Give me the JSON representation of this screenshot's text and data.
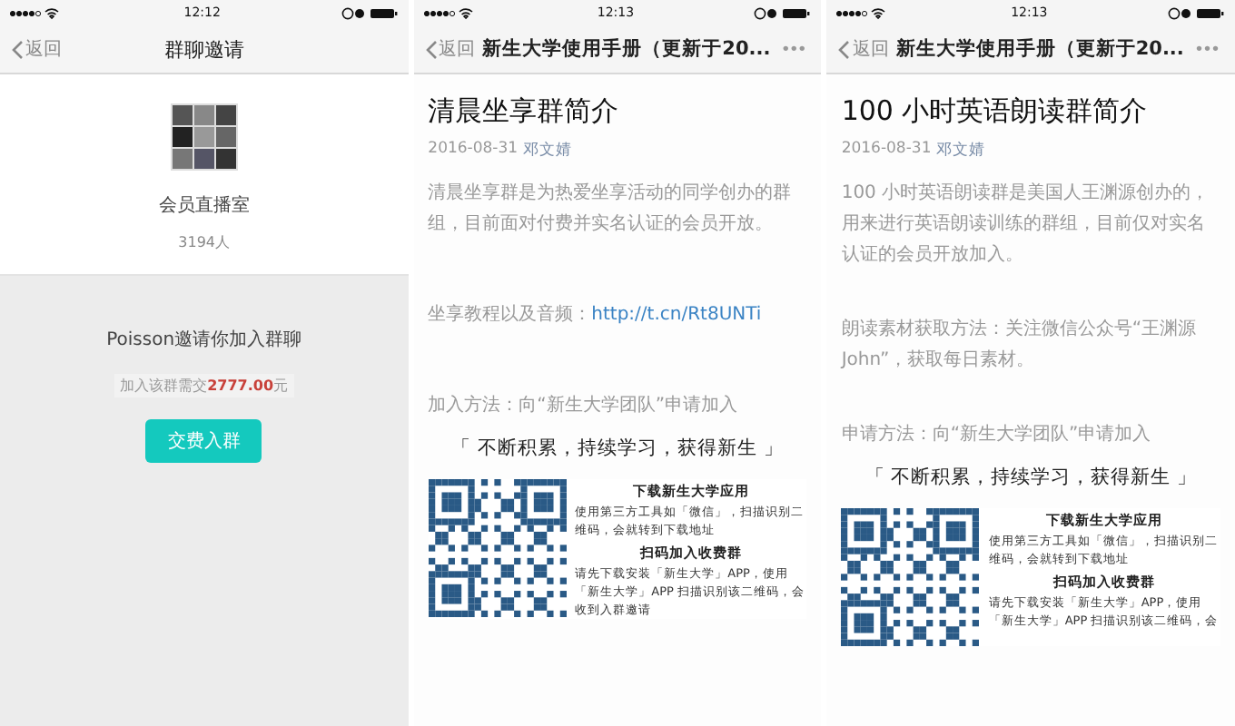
{
  "phones": [
    {
      "kind": "invite",
      "time": "12:12",
      "nav": {
        "back": "返回",
        "title": "群聊邀请"
      },
      "group": {
        "name": "会员直播室",
        "count": "3194人"
      },
      "invite": {
        "text": "Poisson邀请你加入群聊",
        "fee_prefix": "加入该群需交",
        "fee_amount": "2777.00",
        "fee_suffix": "元"
      },
      "button": "交费入群"
    },
    {
      "kind": "article",
      "time": "12:13",
      "nav": {
        "back": "返回",
        "title": "新生大学使用手册（更新于20...",
        "more": "•••"
      },
      "article": {
        "title": "清晨坐享群简介",
        "date": "2016-08-31",
        "author": "邓文婧",
        "paragraphs": [
          {
            "text": "清晨坐享群是为热爱坐享活动的同学创办的群组，目前面对付费并实名认证的会员开放。"
          },
          {
            "text": "坐享教程以及音频：",
            "link": "http://t.cn/Rt8UNTi"
          },
          {
            "text": "加入方法：向“新生大学团队”申请加入"
          }
        ],
        "quote": "「 不断积累，持续学习，获得新生 」",
        "qr_sections": [
          {
            "title": "下载新生大学应用",
            "text": "使用第三方工具如「微信」，扫描识别二维码，会就转到下载地址"
          },
          {
            "title": "扫码加入收费群",
            "text": "请先下载安装「新生大学」APP，使用「新生大学」APP 扫描识别该二维码，会收到入群邀请"
          }
        ]
      }
    },
    {
      "kind": "article",
      "time": "12:13",
      "nav": {
        "back": "返回",
        "title": "新生大学使用手册（更新于20...",
        "more": "•••"
      },
      "article": {
        "title": "100 小时英语朗读群简介",
        "date": "2016-08-31",
        "author": "邓文婧",
        "paragraphs": [
          {
            "text": "100 小时英语朗读群是美国人王渊源创办的，用来进行英语朗读训练的群组，目前仅对实名认证的会员开放加入。"
          },
          {
            "text": "朗读素材获取方法：关注微信公众号“王渊源John”，获取每日素材。"
          },
          {
            "text": "申请方法：向“新生大学团队”申请加入"
          }
        ],
        "quote": "「 不断积累，持续学习，获得新生 」",
        "qr_sections": [
          {
            "title": "下载新生大学应用",
            "text": "使用第三方工具如「微信」，扫描识别二维码，会就转到下载地址"
          },
          {
            "title": "扫码加入收费群",
            "text": "请先下载安装「新生大学」APP，使用「新生大学」APP 扫描识别该二维码，会"
          }
        ]
      }
    }
  ]
}
